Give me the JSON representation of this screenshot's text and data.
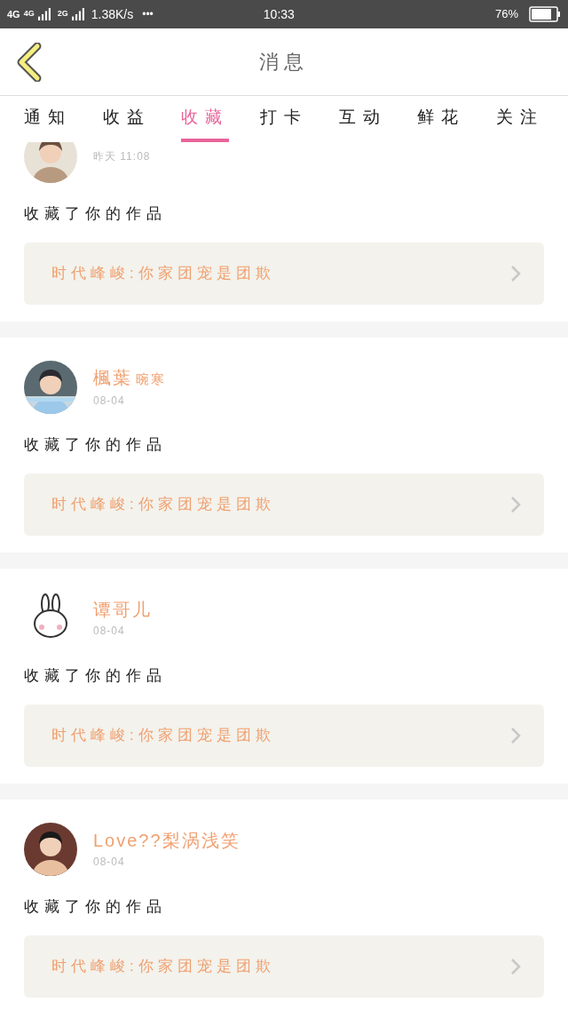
{
  "status_bar": {
    "network_1": "4G",
    "network_2": "4G",
    "network_3": "2G",
    "speed": "1.38K/s",
    "more": "•••",
    "time": "10:33",
    "battery": "76%"
  },
  "header": {
    "title": "消息"
  },
  "tabs": [
    {
      "label": "通知",
      "selected": false
    },
    {
      "label": "收益",
      "selected": false
    },
    {
      "label": "收藏",
      "selected": true
    },
    {
      "label": "打卡",
      "selected": false
    },
    {
      "label": "互动",
      "selected": false
    },
    {
      "label": "鲜花",
      "selected": false
    },
    {
      "label": "关注",
      "selected": false
    }
  ],
  "messages": [
    {
      "time": "昨天 11:08",
      "text": "收藏了你的作品",
      "work": "时代峰峻:你家团宠是团欺"
    },
    {
      "name": "楓葉",
      "name_suffix": "晼寒",
      "time": "08-04",
      "text": "收藏了你的作品",
      "work": "时代峰峻:你家团宠是团欺"
    },
    {
      "name": "谭哥儿",
      "time": "08-04",
      "text": "收藏了你的作品",
      "work": "时代峰峻:你家团宠是团欺"
    },
    {
      "name": "Love??梨涡浅笑",
      "time": "08-04",
      "text": "收藏了你的作品",
      "work": "时代峰峻:你家团宠是团欺"
    }
  ]
}
